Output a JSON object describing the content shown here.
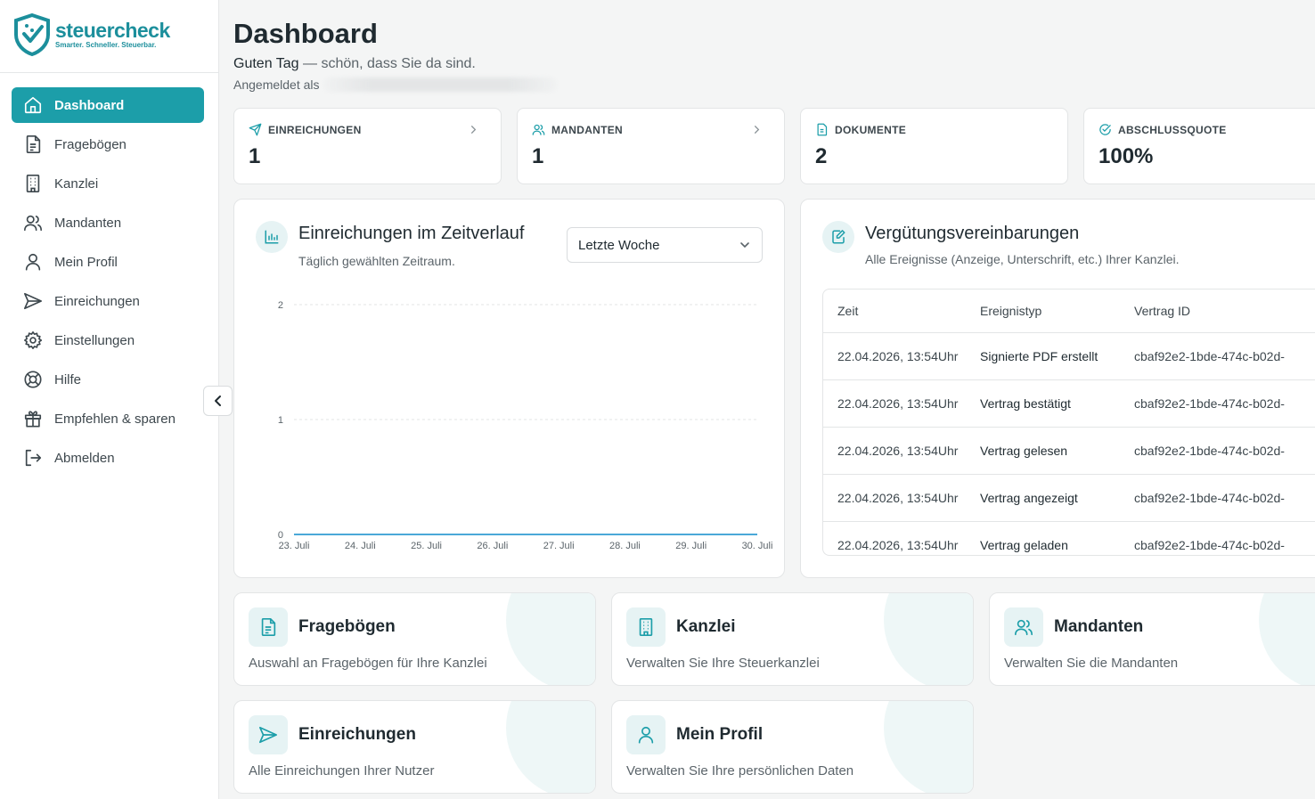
{
  "brand": {
    "name": "steuercheck",
    "tagline": "Smarter. Schneller. Steuerbar.",
    "accent": "#1c9ea9"
  },
  "sidebar": {
    "items": [
      {
        "label": "Dashboard",
        "icon": "home-icon",
        "active": true
      },
      {
        "label": "Fragebögen",
        "icon": "document-icon"
      },
      {
        "label": "Kanzlei",
        "icon": "building-icon"
      },
      {
        "label": "Mandanten",
        "icon": "users-icon"
      },
      {
        "label": "Mein Profil",
        "icon": "user-icon"
      },
      {
        "label": "Einreichungen",
        "icon": "send-icon"
      },
      {
        "label": "Einstellungen",
        "icon": "gear-icon"
      },
      {
        "label": "Hilfe",
        "icon": "lifebuoy-icon"
      },
      {
        "label": "Empfehlen & sparen",
        "icon": "gift-icon"
      },
      {
        "label": "Abmelden",
        "icon": "logout-icon"
      }
    ]
  },
  "header": {
    "title": "Dashboard",
    "greeting_bold": "Guten Tag",
    "greeting_rest": " — schön, dass Sie da sind.",
    "logged_in_as": "Angemeldet als"
  },
  "stats": [
    {
      "label": "EINREICHUNGEN",
      "value": "1",
      "icon": "send-icon",
      "link": true
    },
    {
      "label": "MANDANTEN",
      "value": "1",
      "icon": "users-icon",
      "link": true
    },
    {
      "label": "DOKUMENTE",
      "value": "2",
      "icon": "document-icon",
      "link": false
    },
    {
      "label": "ABSCHLUSSQUOTE",
      "value": "100%",
      "icon": "check-circle-icon",
      "link": false
    }
  ],
  "chart_panel": {
    "title": "Einreichungen im Zeitverlauf",
    "subtitle": "Täglich gewählten Zeitraum.",
    "range_select": "Letzte Woche"
  },
  "chart_data": {
    "type": "area",
    "title": "Einreichungen im Zeitverlauf",
    "categories": [
      "23. Juli",
      "24. Juli",
      "25. Juli",
      "26. Juli",
      "27. Juli",
      "28. Juli",
      "29. Juli",
      "30. Juli"
    ],
    "series": [
      {
        "values": [
          0,
          0,
          0,
          0,
          0,
          0,
          0,
          0
        ]
      }
    ],
    "yticks": [
      "0",
      "1",
      "2"
    ],
    "ylim": [
      0,
      2
    ],
    "grid": true,
    "line_color": "#4aa8d8"
  },
  "fee_panel": {
    "title": "Vergütungsvereinbarungen",
    "subtitle": "Alle Ereignisse (Anzeige, Unterschrift, etc.) Ihrer Kanzlei.",
    "columns": [
      "Zeit",
      "Ereignistyp",
      "Vertrag ID"
    ],
    "rows": [
      [
        "22.04.2026, 13:54Uhr",
        "Signierte PDF erstellt",
        "cbaf92e2-1bde-474c-b02d-"
      ],
      [
        "22.04.2026, 13:54Uhr",
        "Vertrag bestätigt",
        "cbaf92e2-1bde-474c-b02d-"
      ],
      [
        "22.04.2026, 13:54Uhr",
        "Vertrag gelesen",
        "cbaf92e2-1bde-474c-b02d-"
      ],
      [
        "22.04.2026, 13:54Uhr",
        "Vertrag angezeigt",
        "cbaf92e2-1bde-474c-b02d-"
      ],
      [
        "22.04.2026, 13:54Uhr",
        "Vertrag geladen",
        "cbaf92e2-1bde-474c-b02d-"
      ]
    ]
  },
  "quick_links": [
    {
      "title": "Fragebögen",
      "subtitle": "Auswahl an Fragebögen für Ihre Kanzlei",
      "icon": "document-icon"
    },
    {
      "title": "Kanzlei",
      "subtitle": "Verwalten Sie Ihre Steuerkanzlei",
      "icon": "building-icon"
    },
    {
      "title": "Mandanten",
      "subtitle": "Verwalten Sie die Mandanten",
      "icon": "users-icon"
    },
    {
      "title": "Einreichungen",
      "subtitle": "Alle Einreichungen Ihrer Nutzer",
      "icon": "send-icon"
    },
    {
      "title": "Mein Profil",
      "subtitle": "Verwalten Sie Ihre persönlichen Daten",
      "icon": "user-icon"
    }
  ]
}
